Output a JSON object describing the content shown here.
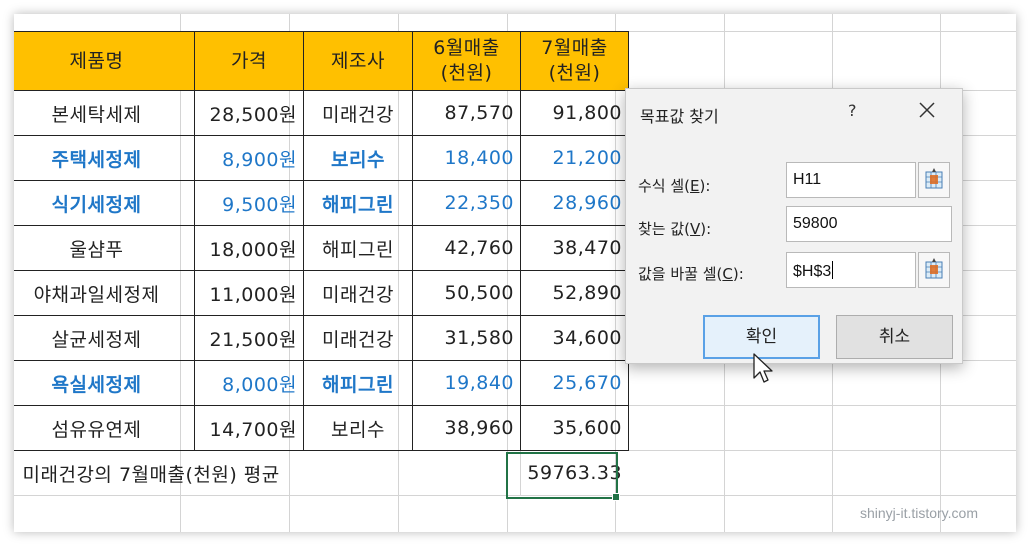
{
  "table": {
    "headers": [
      "제품명",
      "가격",
      "제조사",
      "6월매출\n(천원)",
      "7월매출\n(천원)"
    ],
    "rows": [
      {
        "name": "본세탁세제",
        "price": "28,500원",
        "maker": "미래건강",
        "jun": "87,570",
        "jul": "91,800",
        "highlight": false
      },
      {
        "name": "주택세정제",
        "price": "8,900원",
        "maker": "보리수",
        "jun": "18,400",
        "jul": "21,200",
        "highlight": true
      },
      {
        "name": "식기세정제",
        "price": "9,500원",
        "maker": "해피그린",
        "jun": "22,350",
        "jul": "28,960",
        "highlight": true
      },
      {
        "name": "울샴푸",
        "price": "18,000원",
        "maker": "해피그린",
        "jun": "42,760",
        "jul": "38,470",
        "highlight": false
      },
      {
        "name": "야채과일세정제",
        "price": "11,000원",
        "maker": "미래건강",
        "jun": "50,500",
        "jul": "52,890",
        "highlight": false
      },
      {
        "name": "살균세정제",
        "price": "21,500원",
        "maker": "미래건강",
        "jun": "31,580",
        "jul": "34,600",
        "highlight": false
      },
      {
        "name": "욕실세정제",
        "price": "8,000원",
        "maker": "해피그린",
        "jun": "19,840",
        "jul": "25,670",
        "highlight": true
      },
      {
        "name": "섬유유연제",
        "price": "14,700원",
        "maker": "보리수",
        "jun": "38,960",
        "jul": "35,600",
        "highlight": false
      }
    ],
    "summary_label": "미래건강의 7월매출(천원) 평균",
    "summary_value": "59763.33"
  },
  "dialog": {
    "title": "목표값 찾기",
    "help": "?",
    "formula_cell_label": "수식 셀(",
    "formula_cell_key": "E",
    "formula_cell_value": "H11",
    "target_value_label": "찾는 값(",
    "target_value_key": "V",
    "target_value": "59800",
    "changing_cell_label": "값을 바꿀 셀(",
    "changing_cell_key": "C",
    "changing_cell_value": "$H$3",
    "ok_label": "확인",
    "cancel_label": "취소",
    "label_suffix": "):"
  },
  "watermark": "shinyj-it.tistory.com",
  "colors": {
    "header_fill": "#ffc000",
    "highlight_text": "#1f77c8",
    "selection_border": "#217346",
    "ok_border": "#5aa1e6"
  }
}
